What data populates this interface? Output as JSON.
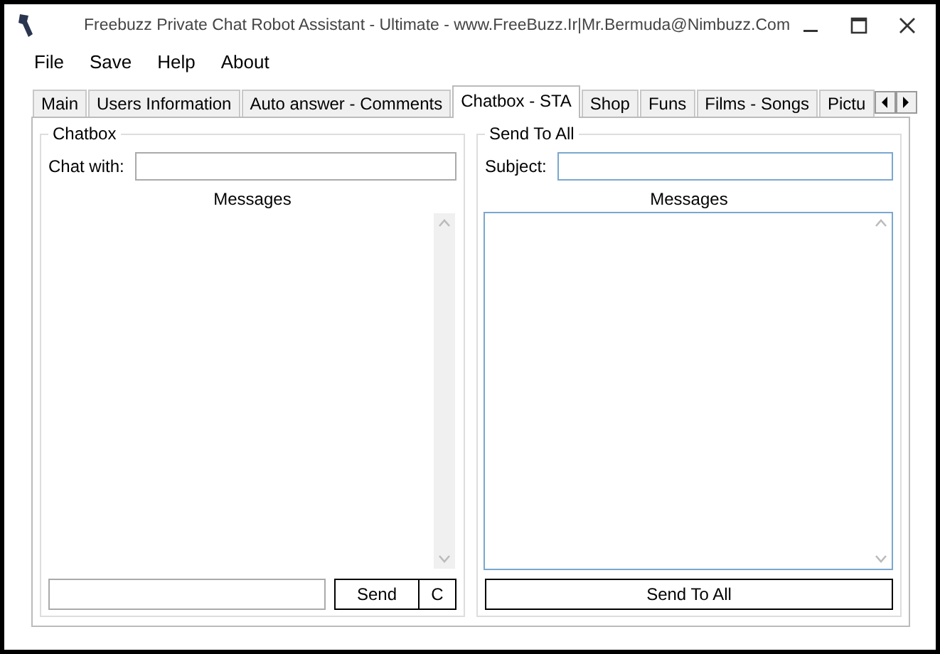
{
  "window": {
    "title": "Freebuzz  Private Chat Robot Assistant - Ultimate - www.FreeBuzz.Ir|Mr.Bermuda@Nimbuzz.Com"
  },
  "menu": [
    "File",
    "Save",
    "Help",
    "About"
  ],
  "tabs": [
    {
      "label": "Main",
      "selected": false
    },
    {
      "label": "Users Information",
      "selected": false
    },
    {
      "label": "Auto answer - Comments",
      "selected": false
    },
    {
      "label": "Chatbox - STA",
      "selected": true
    },
    {
      "label": "Shop",
      "selected": false
    },
    {
      "label": "Funs",
      "selected": false
    },
    {
      "label": "Films - Songs",
      "selected": false
    },
    {
      "label": "Pictu",
      "selected": false
    }
  ],
  "chatbox": {
    "title": "Chatbox",
    "chat_with_label": "Chat with:",
    "messages_label": "Messages",
    "send_button": "Send",
    "clear_button": "C"
  },
  "send_to_all": {
    "title": "Send To All",
    "subject_label": "Subject:",
    "messages_label": "Messages",
    "send_button": "Send To All"
  }
}
